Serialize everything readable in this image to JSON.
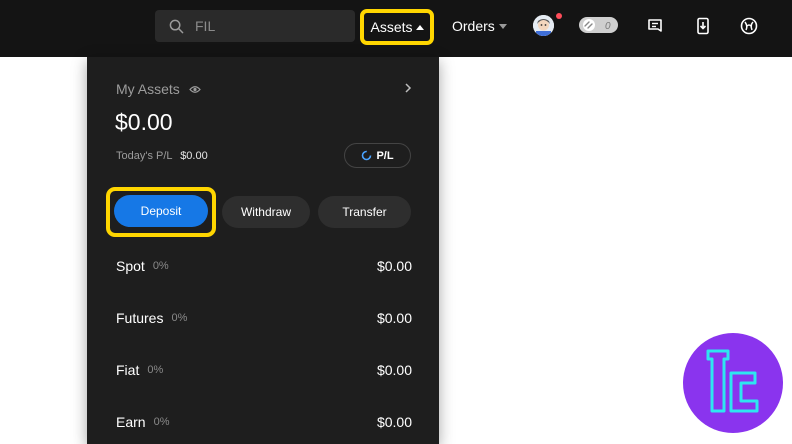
{
  "header": {
    "search_placeholder": "FIL",
    "nav": {
      "assets": "Assets",
      "orders": "Orders"
    },
    "toggle_label": "0"
  },
  "assets_panel": {
    "my_assets": "My Assets",
    "balance": "$0.00",
    "todays_pl_label": "Today's P/L",
    "todays_pl_value": "$0.00",
    "pl_button": "P/L",
    "buttons": {
      "deposit": "Deposit",
      "withdraw": "Withdraw",
      "transfer": "Transfer"
    },
    "accounts": [
      {
        "name": "Spot",
        "percent": "0%",
        "value": "$0.00"
      },
      {
        "name": "Futures",
        "percent": "0%",
        "value": "$0.00"
      },
      {
        "name": "Fiat",
        "percent": "0%",
        "value": "$0.00"
      },
      {
        "name": "Earn",
        "percent": "0%",
        "value": "$0.00"
      }
    ]
  },
  "icons": {
    "search": "search-icon",
    "avatar": "avatar-icon",
    "notification_dot": "notification-dot",
    "toggle": "chain-toggle-icon",
    "order_list": "order-list-icon",
    "download": "download-icon",
    "globe": "globe-icon",
    "eye": "eye-icon",
    "chevron": "chevron-right-icon",
    "brand_logo": "tradingfinder-logo"
  },
  "colors": {
    "topbar": "#141414",
    "panel": "#1e1e1e",
    "highlight": "#ffd600",
    "deposit_button": "#1678e6",
    "logo_background": "#8a34ee",
    "logo_stroke": "#2ee6f0"
  }
}
